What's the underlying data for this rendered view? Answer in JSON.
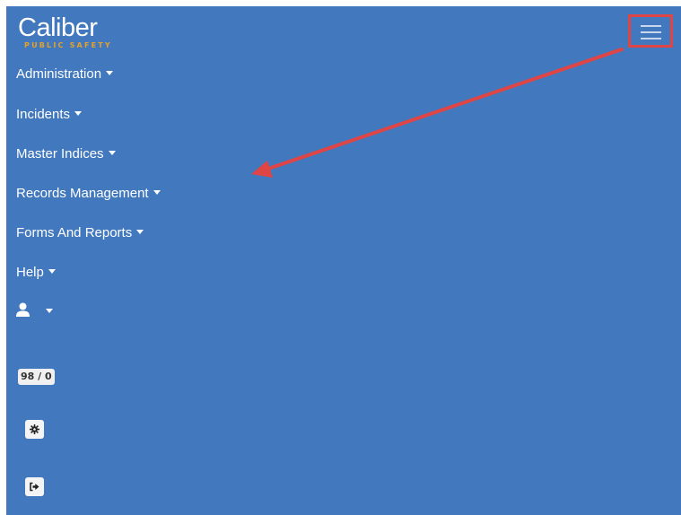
{
  "brand": {
    "name": "Caliber",
    "tagline": "PUBLIC SAFETY"
  },
  "nav": {
    "items": [
      {
        "label": "Administration"
      },
      {
        "label": "Incidents"
      },
      {
        "label": "Master Indices"
      },
      {
        "label": "Records Management"
      },
      {
        "label": "Forms And Reports"
      },
      {
        "label": "Help"
      }
    ]
  },
  "status": {
    "count": "98 / 0"
  },
  "icons": {
    "toggler": "hamburger-icon",
    "user": "user-icon",
    "settings": "gear-icon",
    "logout": "sign-out-icon"
  },
  "colors": {
    "background": "#4278be",
    "annotation": "#e04545",
    "brand_accent": "#e6a12a"
  }
}
